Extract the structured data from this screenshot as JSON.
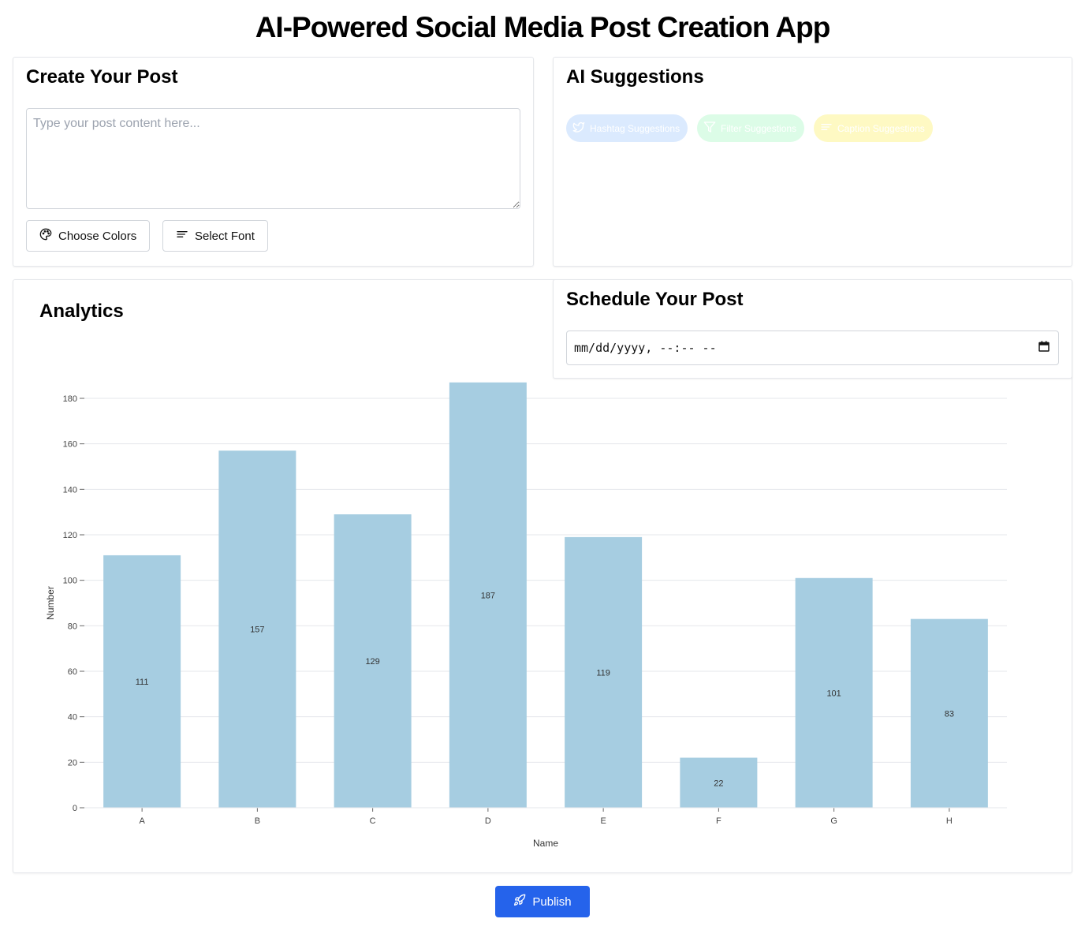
{
  "app": {
    "title": "AI-Powered Social Media Post Creation App"
  },
  "create": {
    "title": "Create Your Post",
    "placeholder": "Type your post content here...",
    "choose_colors_label": "Choose Colors",
    "select_font_label": "Select Font"
  },
  "ai": {
    "title": "AI Suggestions",
    "pills": [
      {
        "label": "Hashtag Suggestions",
        "icon": "twitter-icon",
        "color": "#dbeafe"
      },
      {
        "label": "Filter Suggestions",
        "icon": "filter-icon",
        "color": "#dcfce7"
      },
      {
        "label": "Caption Suggestions",
        "icon": "align-left-icon",
        "color": "#fef9c3"
      }
    ]
  },
  "analytics": {
    "title": "Analytics"
  },
  "schedule": {
    "title": "Schedule Your Post",
    "value": "mm/dd/yyyy, --:-- --"
  },
  "publish": {
    "label": "Publish"
  },
  "chart_data": {
    "type": "bar",
    "categories": [
      "A",
      "B",
      "C",
      "D",
      "E",
      "F",
      "G",
      "H"
    ],
    "values": [
      111,
      157,
      129,
      187,
      119,
      22,
      101,
      83
    ],
    "xlabel": "Name",
    "ylabel": "Number",
    "ylim": [
      0,
      180
    ],
    "yticks": [
      0,
      20,
      40,
      60,
      80,
      100,
      120,
      140,
      160,
      180
    ],
    "grid": true,
    "bar_color": "#a6cde1"
  },
  "colors": {
    "publish": "#2563eb"
  }
}
